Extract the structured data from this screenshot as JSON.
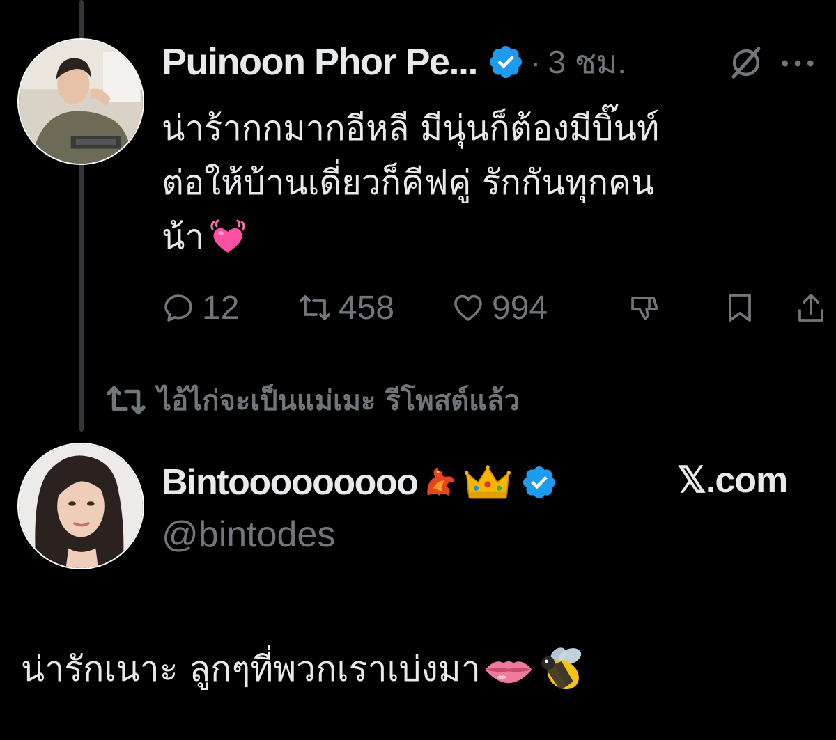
{
  "tweet": {
    "author_name": "Puinoon Phor Pe...",
    "separator": "·",
    "time": "3 ชม.",
    "text_lines": [
      "น่าร้ากกมากอีหลี มีนุ่นก็ต้องมีบิ๊นท์",
      "ต่อให้บ้านเดี่ยวก็คีฟคู่ รักกันทุกคน",
      "น้า"
    ],
    "emoji": "heart-with-motion",
    "counts": {
      "replies": "12",
      "reposts": "458",
      "likes": "994"
    }
  },
  "repost_note": "ไอ้ไก่จะเป็นแม่เมะ รีโพสต์แล้ว",
  "quoted": {
    "author_name": "Bintooooooooo",
    "handle": "@bintodes",
    "source": "𝕏.com",
    "text": "น่ารักเนาะ ลูกๆที่พวกเราเบ่งมา"
  },
  "colors": {
    "background": "#000000",
    "primary_text": "#e7e9ea",
    "secondary_text": "#71767b",
    "verified_badge": "#1d9bf0",
    "thread_line": "#333639"
  }
}
